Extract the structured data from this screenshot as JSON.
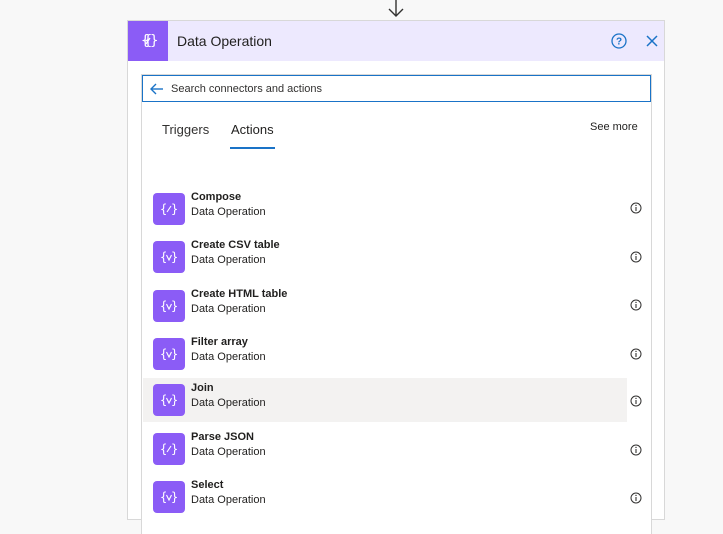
{
  "card": {
    "title": "Data Operation",
    "header_icon": "data-operation-icon",
    "accent_color": "#8b5cf6",
    "header_bg": "#ede9fe"
  },
  "search": {
    "placeholder": "Search connectors and actions",
    "value": ""
  },
  "tabs": [
    {
      "label": "Triggers",
      "active": false
    },
    {
      "label": "Actions",
      "active": true
    }
  ],
  "see_more_label": "See more",
  "actions": [
    {
      "name": "Compose",
      "subtitle": "Data Operation",
      "icon": "compose-icon"
    },
    {
      "name": "Create CSV table",
      "subtitle": "Data Operation",
      "icon": "data-filter-icon"
    },
    {
      "name": "Create HTML table",
      "subtitle": "Data Operation",
      "icon": "data-filter-icon"
    },
    {
      "name": "Filter array",
      "subtitle": "Data Operation",
      "icon": "data-filter-icon"
    },
    {
      "name": "Join",
      "subtitle": "Data Operation",
      "icon": "data-filter-icon",
      "hovered": true
    },
    {
      "name": "Parse JSON",
      "subtitle": "Data Operation",
      "icon": "compose-icon"
    },
    {
      "name": "Select",
      "subtitle": "Data Operation",
      "icon": "data-filter-icon"
    }
  ]
}
